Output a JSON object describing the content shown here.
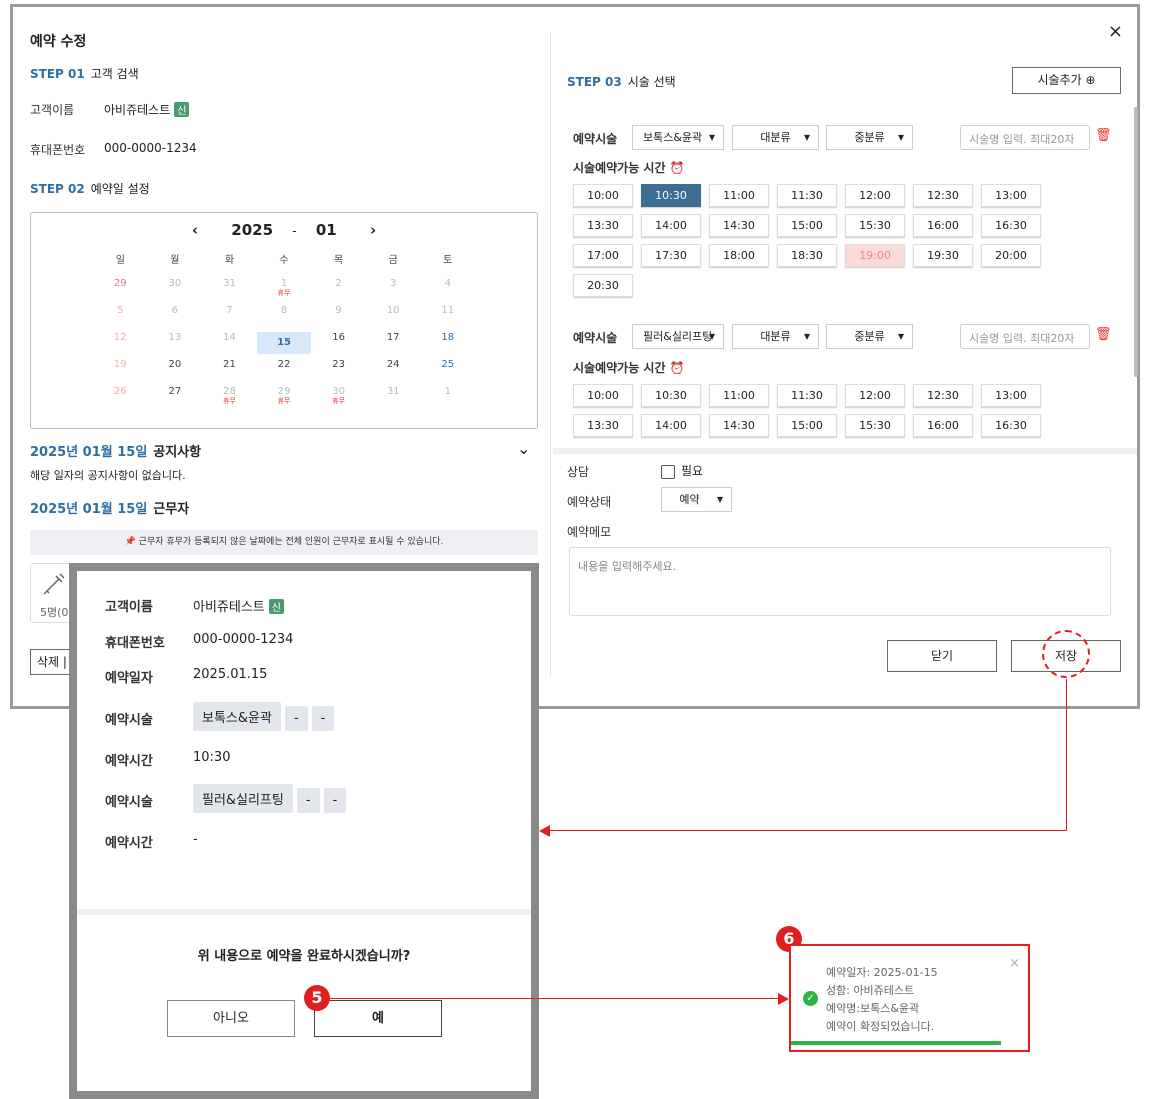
{
  "modal": {
    "title": "예약 수정",
    "close": "×",
    "step1": {
      "num": "STEP 01",
      "label": "고객 검색"
    },
    "customer_name_label": "고객이름",
    "customer_name": "아비쥬테스트",
    "new_badge": "신",
    "phone_label": "휴대폰번호",
    "phone": "000-0000-1234",
    "step2": {
      "num": "STEP 02",
      "label": "예약일 설정"
    },
    "calendar": {
      "prev": "‹",
      "next": "›",
      "year": "2025",
      "sep": "-",
      "month": "01",
      "weekdays": [
        "일",
        "월",
        "화",
        "수",
        "목",
        "금",
        "토"
      ],
      "holiday_label": "휴무"
    },
    "notice": {
      "date": "2025년 01월 15일",
      "title": "공지사항",
      "text": "해당 일자의 공지사항이 없습니다.",
      "toggle": "⌄"
    },
    "workers": {
      "date": "2025년 01월 15일",
      "title": "근무자"
    },
    "info_text": "📌 근무자 휴무가 등록되지 않은 날짜에는 전체 인원이 근무자로 표시될 수 있습니다.",
    "worker_count": "5명(0",
    "delete_button": "삭제 |",
    "step3": {
      "num": "STEP 03",
      "label": "시술 선택"
    },
    "add_procedure": "시술추가 ⊕",
    "procedure_label": "예약시술",
    "available_time_label": "시술예약가능 시간 ⏰",
    "major_category": "대분류",
    "minor_category": "중분류",
    "search_placeholder": "시술명 입력. 최대20자",
    "procedure1": "보톡스&윤곽",
    "procedure2": "필러&실리프팅",
    "times1": [
      "10:00",
      "10:30",
      "11:00",
      "11:30",
      "12:00",
      "12:30",
      "13:00",
      "13:30",
      "14:00",
      "14:30",
      "15:00",
      "15:30",
      "16:00",
      "16:30",
      "17:00",
      "17:30",
      "18:00",
      "18:30",
      "19:00",
      "19:30",
      "20:00",
      "20:30"
    ],
    "times2": [
      "10:00",
      "10:30",
      "11:00",
      "11:30",
      "12:00",
      "12:30",
      "13:00",
      "13:30",
      "14:00",
      "14:30",
      "15:00",
      "15:30",
      "16:00",
      "16:30"
    ],
    "consult_label": "상담",
    "consult_option": "필요",
    "status_label": "예약상태",
    "status_value": "예약",
    "memo_label": "예약메모",
    "memo_placeholder": "내용을 입력해주세요.",
    "close_button": "닫기",
    "save_button": "저장"
  },
  "confirm": {
    "name_label": "고객이름",
    "name": "아비쥬테스트",
    "new_badge": "신",
    "phone_label": "휴대폰번호",
    "phone": "000-0000-1234",
    "date_label": "예약일자",
    "date": "2025.01.15",
    "proc1_label": "예약시술",
    "proc1": "보톡스&윤곽",
    "time1_label": "예약시간",
    "time1": "10:30",
    "proc2_label": "예약시술",
    "proc2": "필러&실리프팅",
    "time2_label": "예약시간",
    "time2": "-",
    "dash": "-",
    "question": "위 내용으로 예약을 완료하시겠습니까?",
    "no_button": "아니오",
    "yes_button": "예"
  },
  "callouts": {
    "five": "5",
    "six": "6"
  },
  "toast": {
    "line1": "예약일자: 2025-01-15",
    "line2": "성함: 아비쥬테스트",
    "line3": "예약명:보톡스&윤곽",
    "line4": "예약이 확정되었습니다.",
    "close": "×"
  }
}
